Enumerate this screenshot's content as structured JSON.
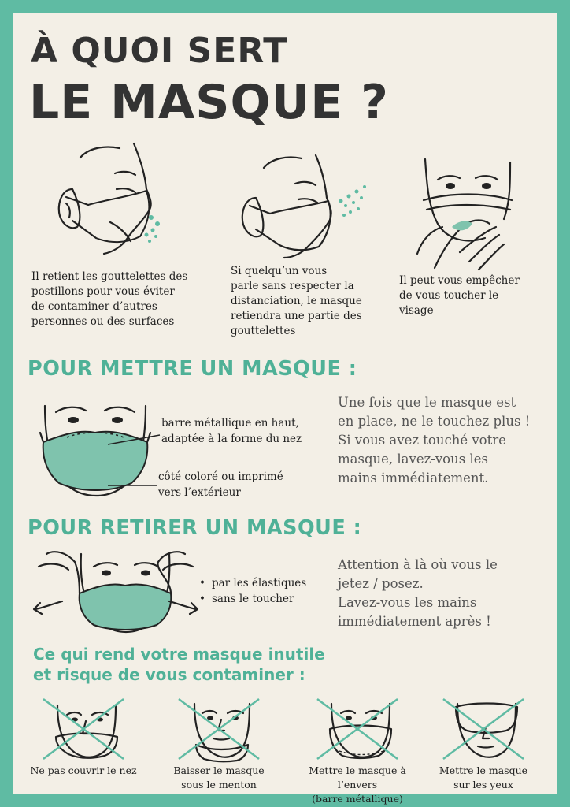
{
  "title": {
    "line1": "À QUOI SERT",
    "line2": "LE MASQUE ?"
  },
  "benefits": [
    {
      "text_lines": [
        "Il retient les gouttelettes des",
        "postillons pour vous éviter",
        "de contaminer d’autres",
        "personnes ou des surfaces"
      ],
      "icon": "face-profile-mask-droplets-icon"
    },
    {
      "text_lines": [
        "Si quelqu’un vous",
        "parle sans respecter la",
        "distanciation, le masque",
        "retiendra une partie des",
        "gouttelettes"
      ],
      "icon": "face-profile-mask-spray-icon"
    },
    {
      "text_lines": [
        "Il peut vous empêcher",
        "de vous toucher le",
        "visage"
      ],
      "icon": "face-hand-touch-icon"
    }
  ],
  "put_on": {
    "heading": "POUR METTRE UN MASQUE :",
    "label_top_lines": [
      "barre métallique en haut,",
      "adaptée à la forme du nez"
    ],
    "label_bottom_lines": [
      "côté coloré ou imprimé",
      "vers l’extérieur"
    ],
    "note_lines": [
      "Une fois que le masque est",
      "en place, ne le touchez plus !",
      "Si vous avez touché votre",
      "masque, lavez-vous les",
      "mains immédiatement."
    ],
    "icon": "face-front-mask-icon"
  },
  "take_off": {
    "heading": "POUR RETIRER UN MASQUE :",
    "bullets": [
      "par les élastiques",
      "sans le toucher"
    ],
    "note_lines": [
      "Attention à là où vous le",
      "jetez / posez.",
      "Lavez-vous les mains",
      "immédiatement après !"
    ],
    "icon": "hands-removing-mask-icon"
  },
  "wrong": {
    "heading_lines": [
      "Ce qui rend votre masque inutile",
      "et risque de vous contaminer :"
    ],
    "items": [
      {
        "caption_lines": [
          "Ne pas couvrir le nez"
        ],
        "icon": "nose-uncovered-icon"
      },
      {
        "caption_lines": [
          "Baisser le masque",
          "sous le menton"
        ],
        "icon": "mask-under-chin-icon"
      },
      {
        "caption_lines": [
          "Mettre le masque à l’envers",
          "(barre métallique)"
        ],
        "icon": "mask-upside-down-icon"
      },
      {
        "caption_lines": [
          "Mettre le masque",
          "sur les yeux"
        ],
        "icon": "mask-over-eyes-icon"
      }
    ]
  },
  "colors": {
    "border": "#5fbba3",
    "accent": "#4fb197",
    "mask": "#7fc3ad",
    "paper": "#f3efe6",
    "title": "#333333"
  }
}
